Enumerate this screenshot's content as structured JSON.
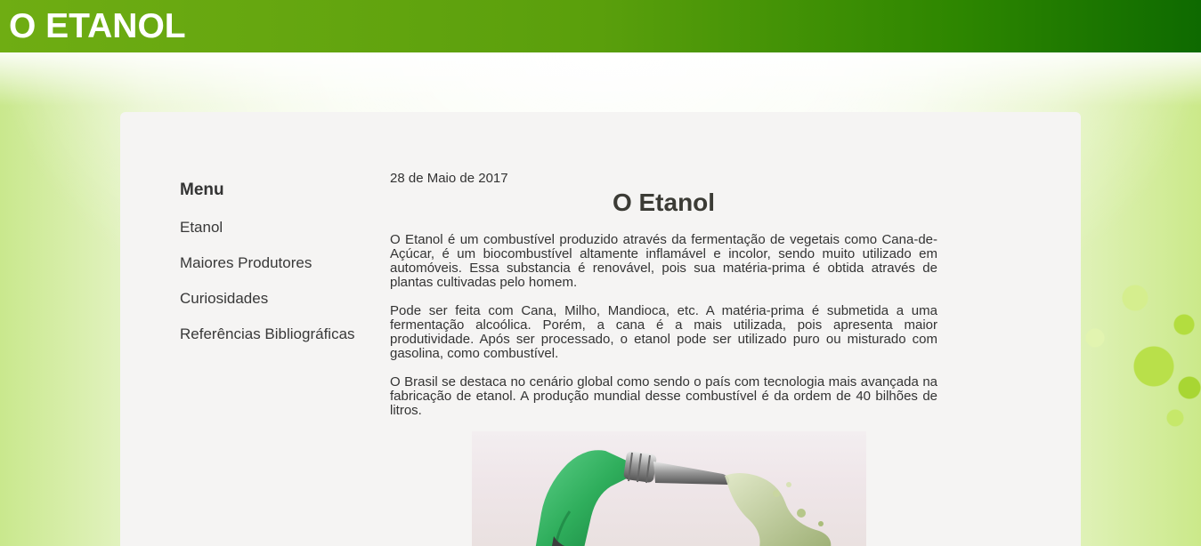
{
  "header": {
    "site_title": "O ETANOL"
  },
  "sidebar": {
    "menu_title": "Menu",
    "items": [
      {
        "label": "Etanol"
      },
      {
        "label": "Maiores Produtores"
      },
      {
        "label": "Curiosidades"
      },
      {
        "label": "Referências Bibliográficas"
      }
    ]
  },
  "article": {
    "date": "28 de Maio de 2017",
    "title": "O Etanol",
    "paragraphs": [
      "O Etanol é um combustível produzido através da fermentação de vegetais como Cana-de-Açúcar, é um biocombustível altamente inflamável e incolor, sendo muito utilizado em automóveis. Essa substancia é renovável, pois sua matéria-prima é obtida através de plantas cultivadas pelo homem.",
      "Pode ser feita com Cana, Milho, Mandioca, etc. A matéria-prima é submetida a uma fermentação alcoólica. Porém, a cana é a mais utilizada, pois apresenta maior produtividade. Após ser processado, o etanol pode ser utilizado puro ou misturado com gasolina, como combustível.",
      "O Brasil se destaca no cenário global como sendo o país com tecnologia mais avançada na fabricação de etanol. A produção mundial desse combustível é da ordem de 40 bilhões de litros."
    ],
    "image_icon": "fuel-nozzle-image"
  },
  "colors": {
    "header_start": "#6fad13",
    "header_end": "#0e6a00",
    "panel_bg": "#f5f4f3",
    "nozzle_green": "#2fae5c",
    "fuel_green": "#b8c98a"
  }
}
